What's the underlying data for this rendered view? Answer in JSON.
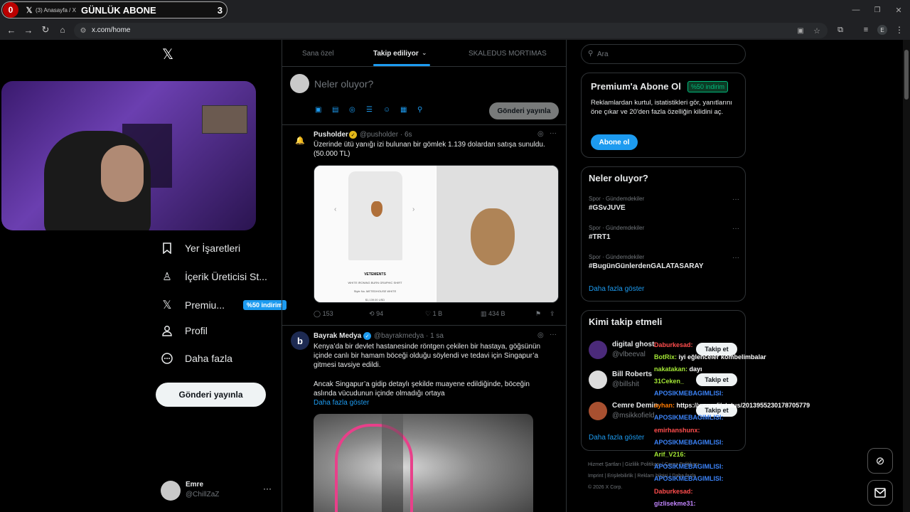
{
  "browser": {
    "tab_title": "(3) Anasayfa / X",
    "overlay_label": "GÜNLÜK ABONE",
    "overlay_left_num": "0",
    "overlay_right_num": "3",
    "url": "x.com/home",
    "profile_letter": "E"
  },
  "sidebar": {
    "items": [
      {
        "label": "Yer İşaretleri",
        "icon": "bookmark-icon"
      },
      {
        "label": "İçerik Üreticisi St...",
        "icon": "creator-studio-icon"
      },
      {
        "label": "Premiu...",
        "icon": "x-logo-icon",
        "badge": "%50 indirim"
      },
      {
        "label": "Profil",
        "icon": "person-icon"
      },
      {
        "label": "Daha fazla",
        "icon": "more-circle-icon"
      }
    ],
    "post_button": "Gönderi yayınla",
    "user": {
      "name": "Emre",
      "handle": "@ChillZaZ"
    }
  },
  "feed": {
    "tabs": [
      "Sana özel",
      "Takip ediliyor",
      "SKALEDUS MORTIMAS"
    ],
    "composer_placeholder": "Neler oluyor?",
    "composer_button": "Gönderi yayınla",
    "tweets": [
      {
        "name": "Pusholder",
        "handle": "@pusholder · 6s",
        "text": "Üzerinde ütü yanığı izi bulunan bir gömlek 1.139 dolardan satışa sunuldu. (50.000 TL)",
        "image_caption": [
          "VETEMENTS",
          "WHITE IRONING BURN GRAPHIC SHIRT",
          "Style No. METEDHOUSE WHITE",
          "$1,139.00 USD"
        ],
        "stats": {
          "replies": "153",
          "reposts": "94",
          "likes": "1 B",
          "views": "434 B"
        }
      },
      {
        "name": "Bayrak Medya",
        "handle": "@bayrakmedya · 1 sa",
        "text1": "Kenya’da bir devlet hastanesinde röntgen çekilen bir hastaya, göğsünün içinde canlı bir hamam böceği olduğu söylendi ve tedavi için Singapur’a gitmesi tavsiye edildi.",
        "text2": "Ancak Singapur’a gidip detaylı şekilde muayene edildiğinde, böceğin aslında vücudunun içinde olmadığı ortaya",
        "show_more": "Daha fazla göster"
      }
    ]
  },
  "right": {
    "search_placeholder": "Ara",
    "premium": {
      "title": "Premium'a Abone Ol",
      "badge": "%50 indirim",
      "text": "Reklamlardan kurtul, istatistikleri gör, yanıtlarını öne çıkar ve 20'den fazla özelliğin kilidini aç.",
      "button": "Abone ol"
    },
    "trends": {
      "title": "Neler oluyor?",
      "items": [
        {
          "cat": "Spor · Gündemdekiler",
          "name": "#GSvJUVE"
        },
        {
          "cat": "Spor · Gündemdekiler",
          "name": "#TRT1"
        },
        {
          "cat": "Spor · Gündemdekiler",
          "name": "#BugünGünlerdenGALATASARAY"
        }
      ],
      "more": "Daha fazla göster"
    },
    "follow": {
      "title": "Kimi takip etmeli",
      "users": [
        {
          "name": "digital ghost",
          "handle": "@vlbeeval"
        },
        {
          "name": "Bill Roberts",
          "handle": "@billshit"
        },
        {
          "name": "Cemre Demin",
          "handle": "@msikkofield"
        }
      ],
      "follow_label": "Takip et",
      "more": "Daha fazla göster"
    },
    "footer": [
      "Hizmet Şartları",
      "Gizlilik Politikası",
      "Çerez Politikası",
      "Imprint",
      "Erişilebilirlik",
      "Reklam bilgisi",
      "Daha fazla ...",
      "© 2026 X Corp."
    ]
  },
  "chat": [
    {
      "user": "Daburkesad:",
      "msg": "",
      "color": "#ff4d4d"
    },
    {
      "user": "BotRix:",
      "msg": "iyi eğlenceler kombelimbalar",
      "color": "#a3e635"
    },
    {
      "user": "nakatakan:",
      "msg": "dayı",
      "color": "#a3e635"
    },
    {
      "user": "31Ceken_",
      "msg": "",
      "color": "#a3e635"
    },
    {
      "user": "APOSIKMEBAGIMLISI:",
      "msg": "",
      "color": "#3b82f6"
    },
    {
      "user": "ayhan:",
      "msg": "https://x.com/i/status/2013955230178705779",
      "color": "#ff7a00"
    },
    {
      "user": "APOSIKMEBAGIMLISI:",
      "msg": "",
      "color": "#3b82f6"
    },
    {
      "user": "emirhanshunx:",
      "msg": "",
      "color": "#ff4d4d"
    },
    {
      "user": "APOSIKMEBAGIMLISI:",
      "msg": "",
      "color": "#3b82f6"
    },
    {
      "user": "Arif_V216:",
      "msg": "",
      "color": "#a3e635"
    },
    {
      "user": "APOSIKMEBAGIMLISI:",
      "msg": "",
      "color": "#3b82f6"
    },
    {
      "user": "APOSIKMEBAGIMLISI:",
      "msg": "",
      "color": "#3b82f6"
    },
    {
      "user": "Daburkesad:",
      "msg": "",
      "color": "#ff4d4d"
    },
    {
      "user": "gizlisekme31:",
      "msg": "",
      "color": "#c084fc"
    }
  ]
}
